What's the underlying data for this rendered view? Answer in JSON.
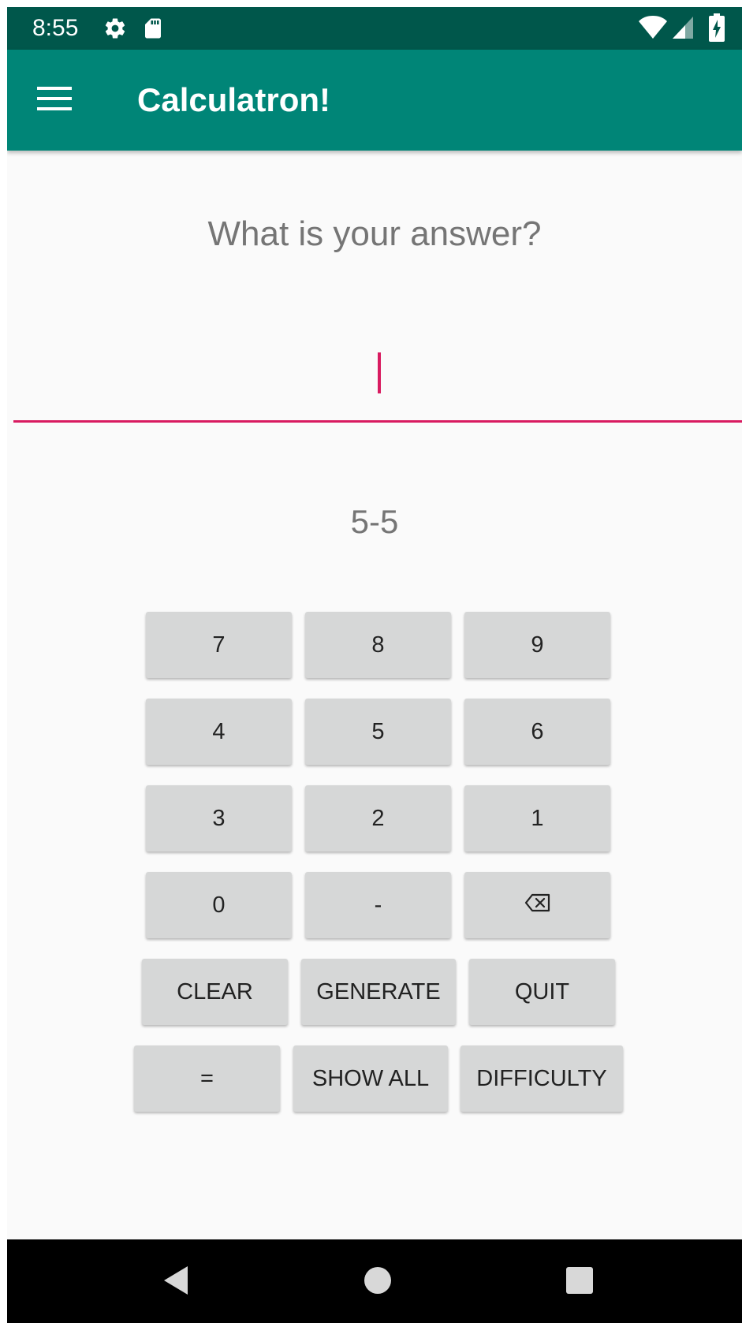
{
  "status_bar": {
    "time": "8:55",
    "icons": [
      "settings-icon",
      "sd-card-icon",
      "wifi-icon",
      "cell-signal-icon",
      "battery-charging-icon"
    ]
  },
  "app_bar": {
    "title": "Calculatron!",
    "background": "#008577",
    "status_background": "#00574b"
  },
  "main": {
    "prompt": "What is your answer?",
    "answer_value": "",
    "problem": "5-5",
    "accent": "#d81b60"
  },
  "keypad": {
    "row1": [
      "7",
      "8",
      "9"
    ],
    "row2": [
      "4",
      "5",
      "6"
    ],
    "row3": [
      "3",
      "2",
      "1"
    ],
    "row4": [
      "0",
      "-"
    ],
    "backspace_icon": "backspace-icon",
    "clear": "CLEAR",
    "generate": "GENERATE",
    "quit": "QUIT",
    "equals": "=",
    "show_all": "SHOW ALL",
    "difficulty": "DIFFICULTY"
  },
  "nav_bar": {
    "icons": [
      "back-icon",
      "home-icon",
      "recents-icon"
    ]
  }
}
